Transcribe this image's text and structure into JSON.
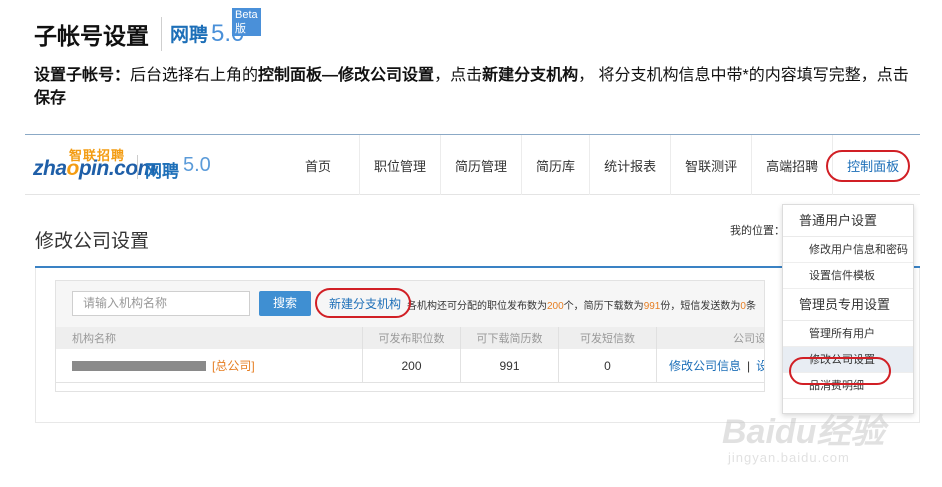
{
  "doc": {
    "title": "子帐号设置",
    "brand": "网聘",
    "version": "5.0",
    "beta": "Beta版",
    "desc": {
      "lead": "设置子帐号：",
      "p1": "后台选择右上角的",
      "b1": "控制面板",
      "p2": "—",
      "b2": "修改公司设置",
      "p3": "，点击",
      "b3": "新建分支机构",
      "p4": "， 将分支机构信息中带*的内容填写完整，点击",
      "b4": "保存"
    }
  },
  "app": {
    "logo": {
      "wordmark_a": "zha",
      "wordmark_o": "o",
      "wordmark_b": "pin.com",
      "cn": "智联招聘",
      "brand": "网聘",
      "version": "5.0"
    },
    "nav": [
      "首页",
      "职位管理",
      "简历管理",
      "简历库",
      "统计报表",
      "智联测评",
      "高端招聘",
      "控制面板"
    ],
    "page_title": "修改公司设置",
    "location": "我的位置：",
    "search_placeholder": "请输入机构名称",
    "search_button": "搜索",
    "new_branch": "新建分支机构",
    "quota": {
      "t1": "各机构还可分配的职位发布数为",
      "n1": "200",
      "t2": "个，简历下载数为",
      "n2": "991",
      "t3": "份，短信发送数为",
      "n3": "0",
      "t4": "条"
    },
    "table": {
      "headers": [
        "机构名称",
        "可发布职位数",
        "可下载简历数",
        "可发短信数",
        "公司设"
      ],
      "row": {
        "hq_tag": "[总公司]",
        "jobs": "200",
        "resumes": "991",
        "sms": "0",
        "action1": "修改公司信息",
        "sep": "|",
        "action2": "设置"
      }
    },
    "dropdown": {
      "group1": "普通用户设置",
      "items1": [
        "修改用户信息和密码",
        "设置信件模板"
      ],
      "group2": "管理员专用设置",
      "items2": [
        "管理所有用户",
        "修改公司设置",
        "品消费明细"
      ]
    }
  },
  "watermark": {
    "main": "Baidu经验",
    "sub": "jingyan.baidu.com"
  },
  "colors": {
    "accent": "#1d6fb8",
    "highlight_ring": "#d11f25",
    "number": "#e67e22"
  }
}
